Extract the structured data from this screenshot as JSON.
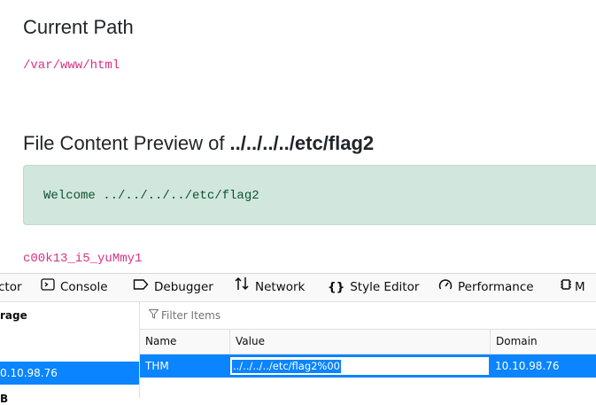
{
  "page": {
    "path_heading": "Current Path",
    "path_value": "/var/www/html",
    "preview_heading_prefix": "File Content Preview of ",
    "preview_heading_file": "../../../../etc/flag2",
    "preview_text": "Welcome ../../../../etc/flag2",
    "flag_value": "c00k13_i5_yuMmy1"
  },
  "devtools": {
    "tabs": [
      {
        "label": "ctor",
        "icon": ""
      },
      {
        "label": "Console",
        "icon": "console-icon"
      },
      {
        "label": "Debugger",
        "icon": "debugger-icon"
      },
      {
        "label": "Network",
        "icon": "network-icon"
      },
      {
        "label": "Style Editor",
        "icon": "braces-icon"
      },
      {
        "label": "Performance",
        "icon": "gauge-icon"
      },
      {
        "label": "M",
        "icon": "memory-icon"
      }
    ],
    "sidebar": {
      "heading": "rage",
      "selected": "0.10.98.76",
      "bottom": "B"
    },
    "filter_placeholder": "Filter Items",
    "columns": [
      "Name",
      "Value",
      "Domain"
    ],
    "row": {
      "name": "THM",
      "value": "../../../../etc/flag2%00",
      "domain": "10.10.98.76"
    }
  },
  "colors": {
    "code_pink": "#d63384",
    "alert_bg": "#d1e7dd",
    "alert_text": "#0f5132",
    "selection_blue": "#0a84ff"
  }
}
